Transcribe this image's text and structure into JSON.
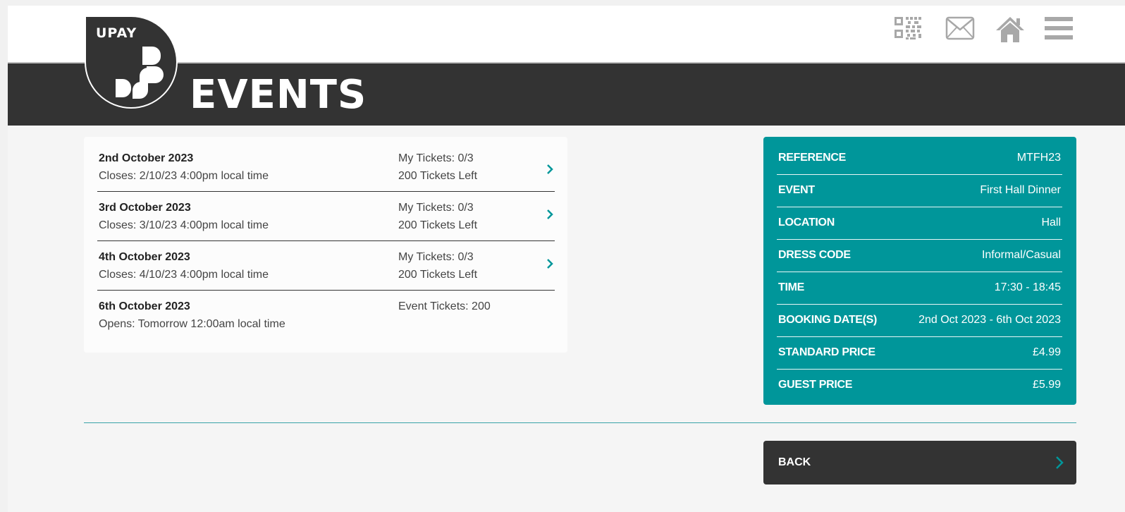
{
  "header": {
    "logo_text": "UPAY",
    "page_title": "EVENTS",
    "icons": [
      "qr-code-icon",
      "mail-icon",
      "home-icon",
      "menu-icon"
    ]
  },
  "events": [
    {
      "date": "2nd October 2023",
      "sub": "Closes: 2/10/23 4:00pm local time",
      "right1": "My Tickets: 0/3",
      "right2": "200 Tickets Left",
      "has_link": true
    },
    {
      "date": "3rd October 2023",
      "sub": "Closes: 3/10/23 4:00pm local time",
      "right1": "My Tickets: 0/3",
      "right2": "200 Tickets Left",
      "has_link": true
    },
    {
      "date": "4th October 2023",
      "sub": "Closes: 4/10/23 4:00pm local time",
      "right1": "My Tickets: 0/3",
      "right2": "200 Tickets Left",
      "has_link": true
    },
    {
      "date": "6th October 2023",
      "sub": "Opens: Tomorrow 12:00am local time",
      "right1": "Event Tickets: 200",
      "right2": "",
      "has_link": false
    }
  ],
  "details": [
    {
      "label": "REFERENCE",
      "value": "MTFH23"
    },
    {
      "label": "EVENT",
      "value": "First Hall Dinner"
    },
    {
      "label": "LOCATION",
      "value": "Hall"
    },
    {
      "label": "DRESS CODE",
      "value": "Informal/Casual"
    },
    {
      "label": "TIME",
      "value": "17:30 - 18:45"
    },
    {
      "label": "BOOKING DATE(S)",
      "value": "2nd Oct 2023 - 6th Oct 2023"
    },
    {
      "label": "STANDARD PRICE",
      "value": "£4.99"
    },
    {
      "label": "GUEST PRICE",
      "value": "£5.99"
    }
  ],
  "back_button": {
    "label": "BACK"
  },
  "colors": {
    "accent": "#00969a",
    "dark": "#333333",
    "background": "#f5f5f5"
  }
}
